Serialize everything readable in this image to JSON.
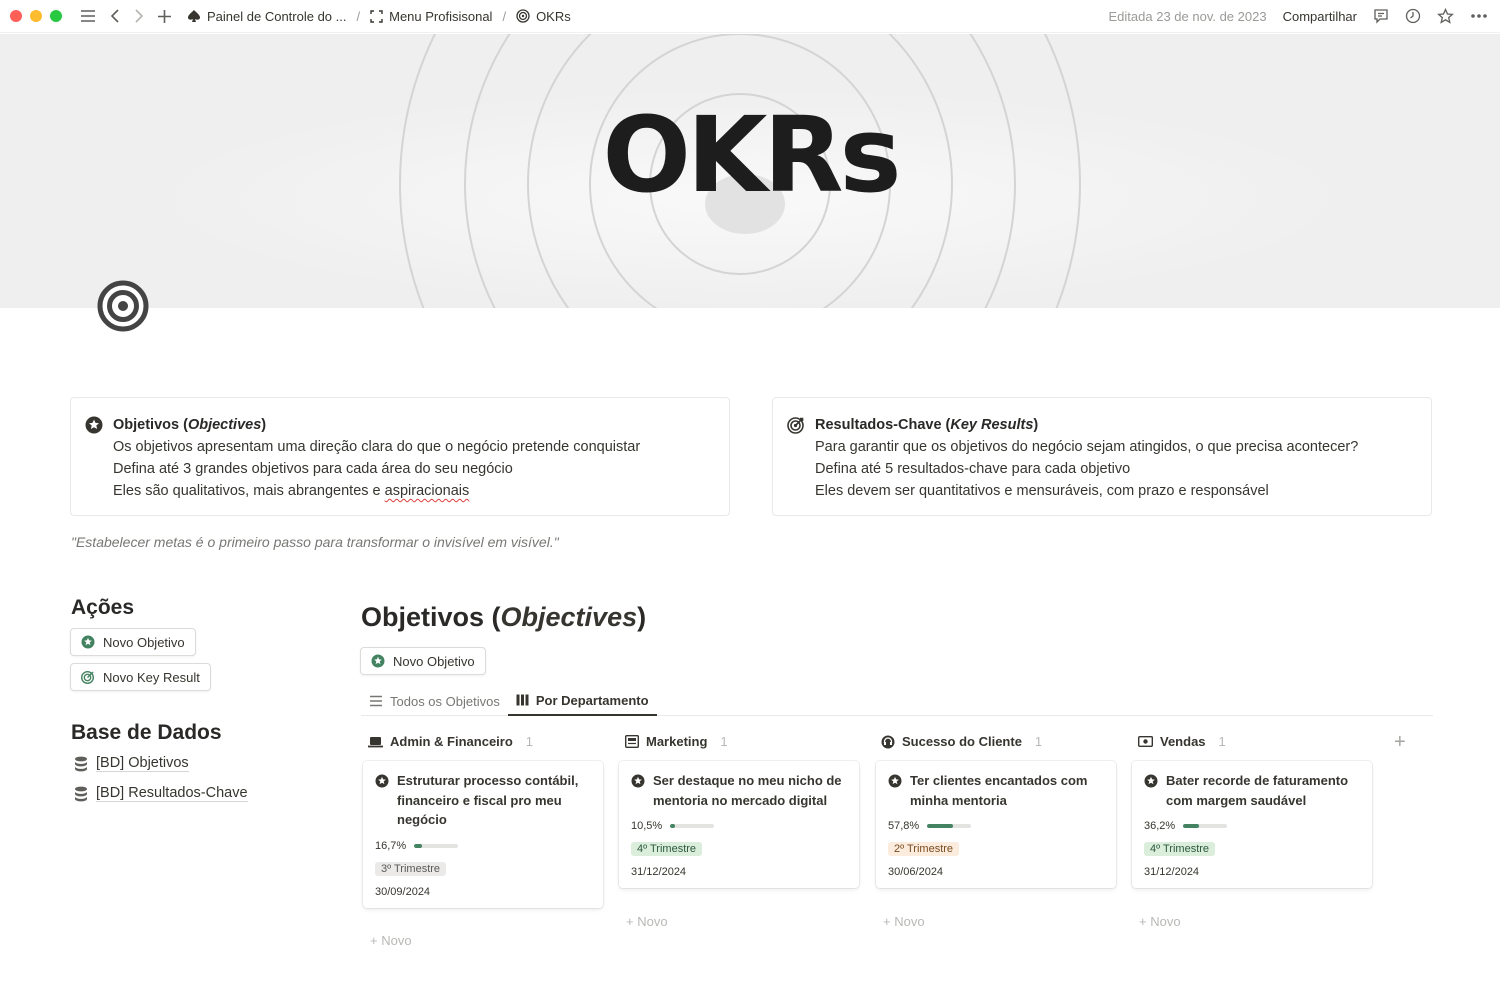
{
  "topbar": {
    "breadcrumbs": [
      "Painel de Controle do ...",
      "Menu Profisisonal",
      "OKRs"
    ],
    "separator": "/",
    "edited": "Editada 23 de nov. de 2023",
    "share": "Compartilhar"
  },
  "cover": {
    "title": "OKRs"
  },
  "callouts": {
    "objectives": {
      "title_prefix": "Objetivos (",
      "title_italic": "Objectives",
      "title_suffix": ")",
      "line1": "Os objetivos apresentam uma direção clara do que o negócio pretende conquistar",
      "line2": "Defina até 3 grandes objetivos para cada área do seu negócio",
      "line3_prefix": "Eles são qualitativos, mais abrangentes e ",
      "line3_underlined": "aspiracionais"
    },
    "key_results": {
      "title_prefix": "Resultados-Chave (",
      "title_italic_1": "Key",
      "title_mid": " ",
      "title_italic_2": "Results",
      "title_suffix": ")",
      "line1": "Para garantir que os objetivos do negócio sejam atingidos, o que precisa acontecer?",
      "line2": "Defina até 5 resultados-chave para cada objetivo",
      "line3": "Eles devem ser quantitativos e mensuráveis, com prazo e responsável"
    }
  },
  "quote": "\"Estabelecer metas é o primeiro passo para transformar o invisível em visível.\"",
  "actions": {
    "heading": "Ações",
    "new_objective": "Novo Objetivo",
    "new_key_result": "Novo Key Result"
  },
  "databases": {
    "heading": "Base de Dados",
    "items": [
      "[BD] Objetivos",
      "[BD] Resultados-Chave"
    ]
  },
  "objectives_section": {
    "title_prefix": "Objetivos (",
    "title_italic": "Objectives",
    "title_suffix": ")",
    "new_button": "Novo Objetivo",
    "tabs": [
      "Todos os Objetivos",
      "Por Departamento"
    ],
    "active_tab": 1
  },
  "board": {
    "new_label": "Novo",
    "columns": [
      {
        "name": "Admin & Financeiro",
        "count": "1",
        "icon": "laptop-icon",
        "card": {
          "title": "Estruturar processo contábil, financeiro e fiscal pro meu negócio",
          "progress_label": "16,7%",
          "progress": 0.167,
          "quarter": "3º Trimestre",
          "quarter_color": "gray",
          "date": "30/09/2024"
        }
      },
      {
        "name": "Marketing",
        "count": "1",
        "icon": "newspaper-icon",
        "card": {
          "title": "Ser destaque no meu nicho de mentoria no mercado digital",
          "progress_label": "10,5%",
          "progress": 0.105,
          "quarter": "4º Trimestre",
          "quarter_color": "green",
          "date": "31/12/2024"
        }
      },
      {
        "name": "Sucesso do Cliente",
        "count": "1",
        "icon": "support-icon",
        "card": {
          "title": "Ter clientes encantados com minha mentoria",
          "progress_label": "57,8%",
          "progress": 0.578,
          "quarter": "2º Trimestre",
          "quarter_color": "orange",
          "date": "30/06/2024"
        }
      },
      {
        "name": "Vendas",
        "count": "1",
        "icon": "cash-icon",
        "card": {
          "title": "Bater recorde de faturamento com margem saudável",
          "progress_label": "36,2%",
          "progress": 0.362,
          "quarter": "4º Trimestre",
          "quarter_color": "green",
          "date": "31/12/2024"
        }
      }
    ]
  }
}
